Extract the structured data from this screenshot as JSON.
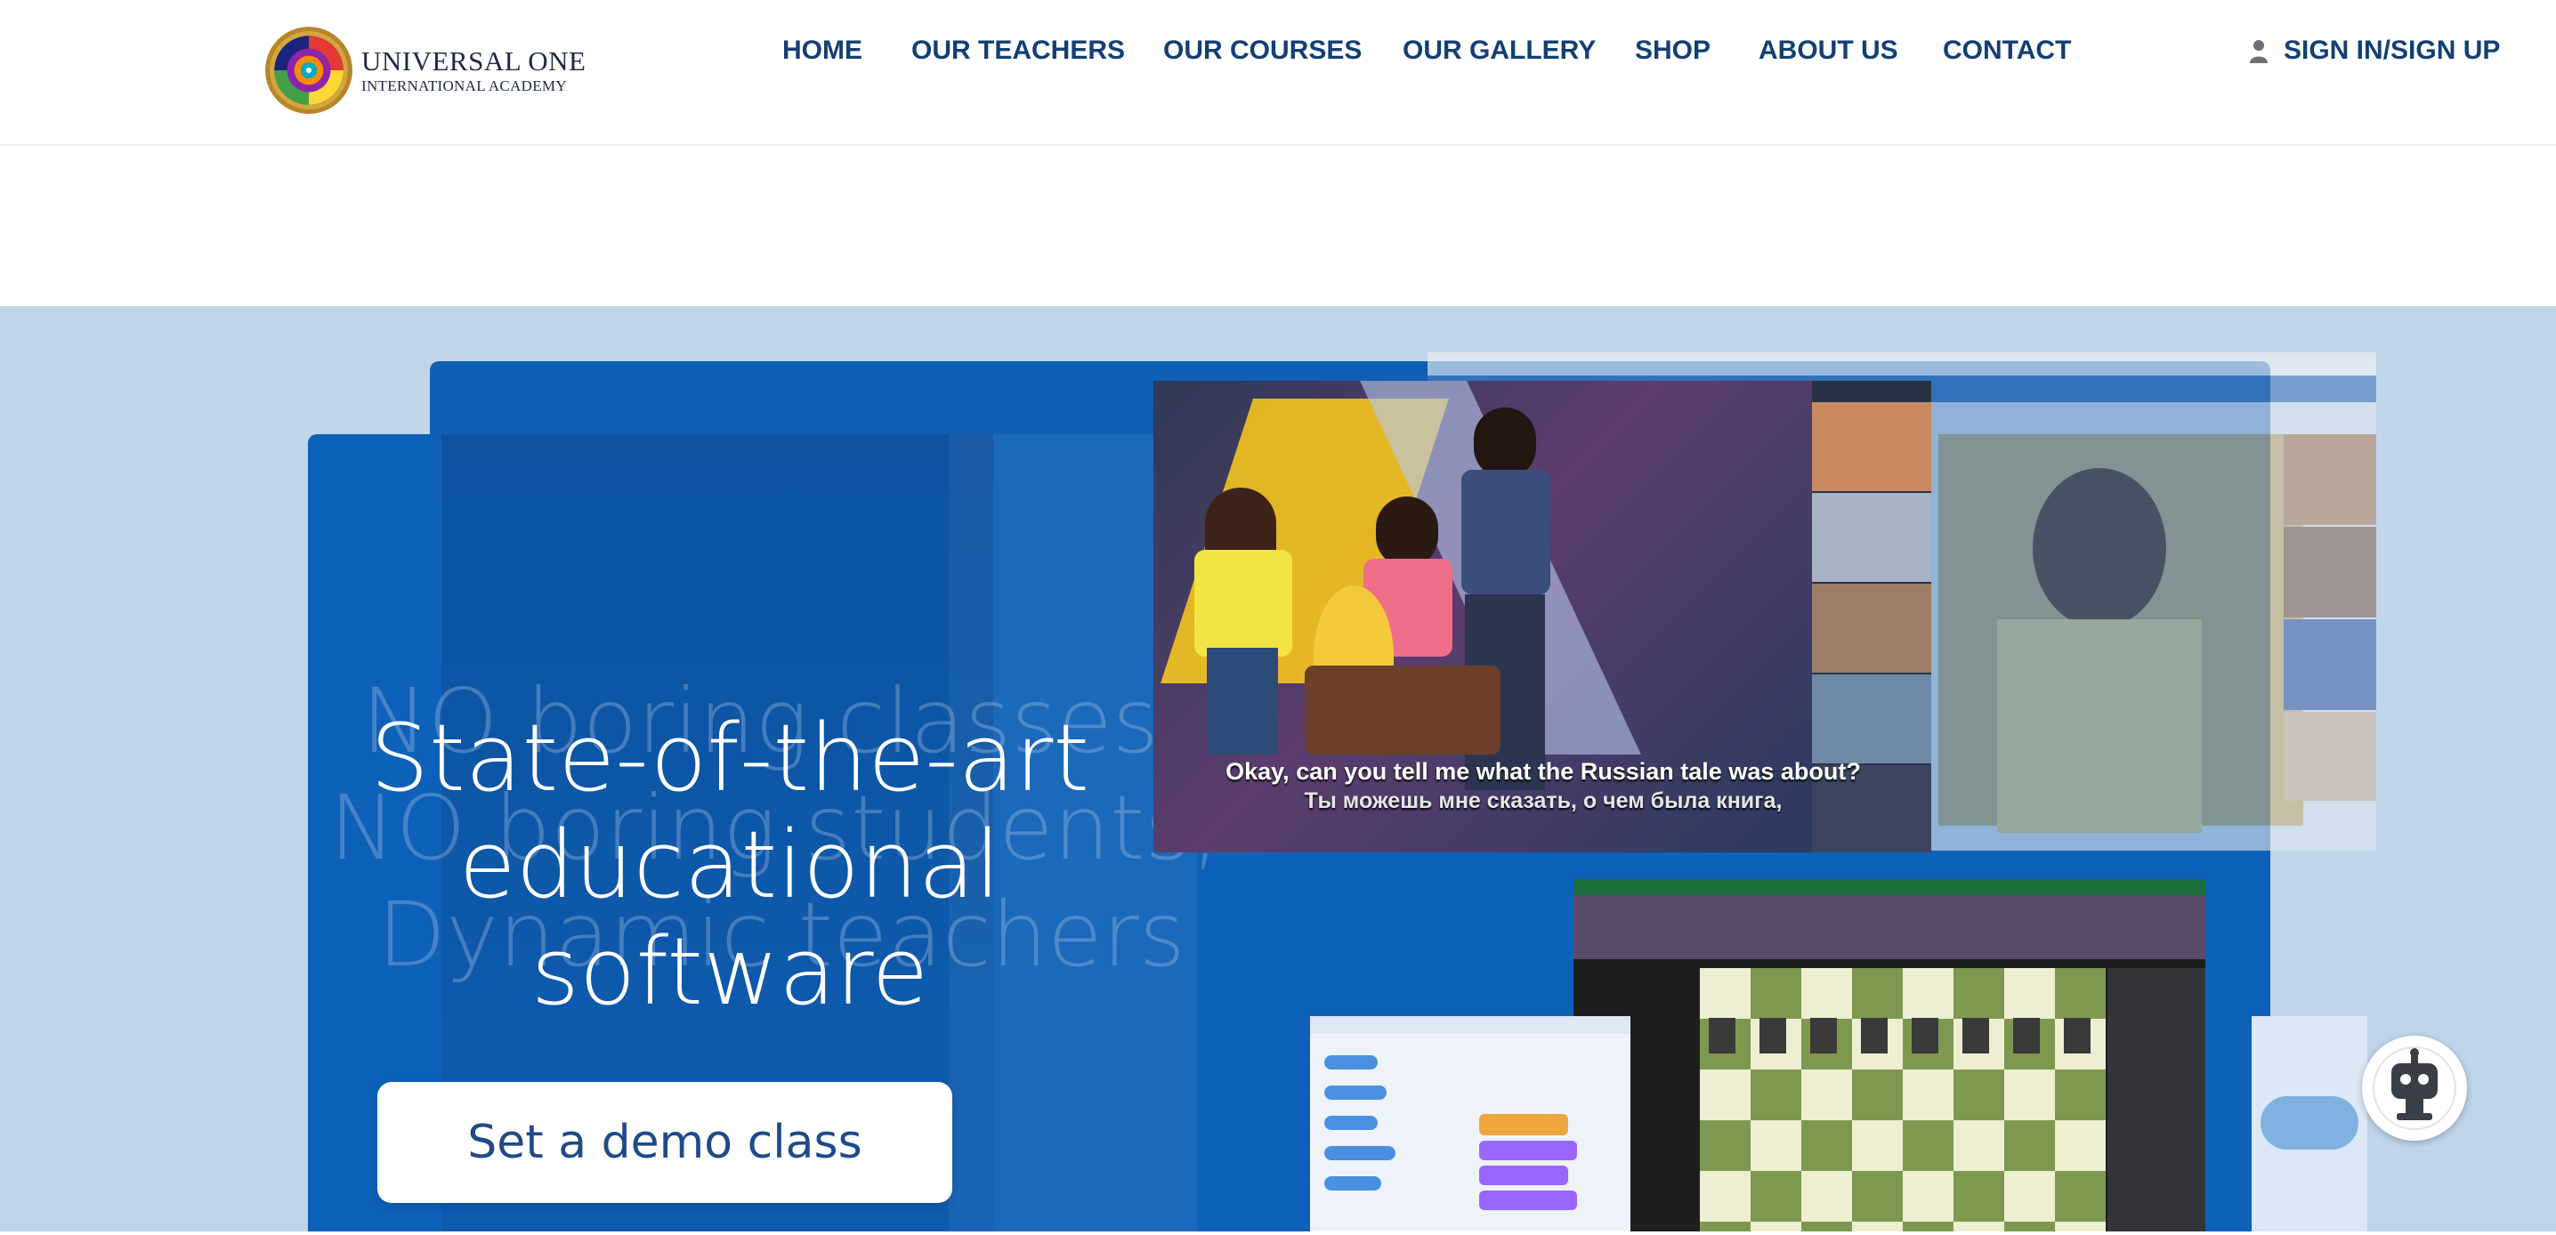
{
  "header": {
    "logo_line1": "UNIVERSAL ONE",
    "logo_line2": "INTERNATIONAL ACADEMY",
    "nav": [
      {
        "label": "HOME"
      },
      {
        "label": "OUR TEACHERS"
      },
      {
        "label": "OUR COURSES"
      },
      {
        "label": "OUR GALLERY"
      },
      {
        "label": "SHOP"
      },
      {
        "label": "ABOUT US"
      },
      {
        "label": "CONTACT"
      }
    ],
    "signin_label": "SIGN IN/SIGN UP",
    "signin_icon": "user-icon"
  },
  "hero": {
    "ghost_lines": [
      "NO boring classes,",
      "NO boring students,",
      "Dynamic teachers"
    ],
    "headline": [
      "State-of-the-art",
      "educational",
      "software"
    ],
    "cta_label": "Set a demo class",
    "video_caption_en": "Okay, can you tell me what the Russian tale was about?",
    "video_caption_ru": "Ты можешь мне сказать, о чем была книга,"
  },
  "chat_widget": {
    "icon": "robot-chat-icon"
  },
  "colors": {
    "nav_text": "#133f73",
    "hero_bg": "#bfd5ea",
    "card_blue": "#0e61b8",
    "cta_text": "#1f4a8a"
  }
}
